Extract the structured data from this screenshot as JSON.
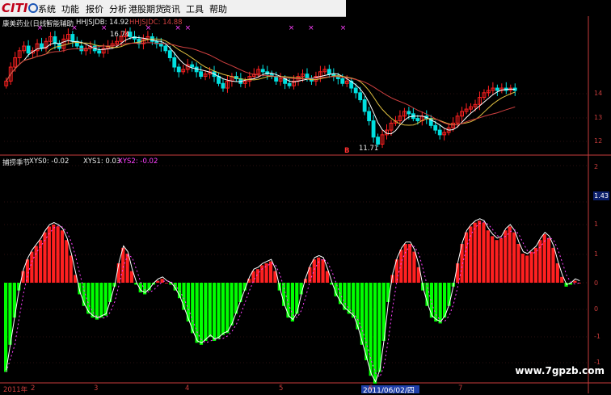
{
  "menu": {
    "logo_text": "CITI",
    "items": [
      "系统",
      "功能",
      "报价",
      "分析",
      "港股期货",
      "资讯",
      "工具",
      "帮助"
    ]
  },
  "top_panel": {
    "title": "康美药业(日线)",
    "indicator_name": "智能辅助",
    "line1_label": "HHJSJDB: 14.92",
    "line2_label": "HHJSJDC: 14.88",
    "high_marker": "16.74",
    "low_marker": "11.71",
    "y_ticks": [
      "14",
      "13",
      "12"
    ],
    "sell_marker_symbol": "×",
    "buy_marker_symbol": "B"
  },
  "bottom_panel": {
    "title": "捕捞季节",
    "xys0_label": "XYS0: -0.02",
    "xys1_label": "XYS1: 0.03",
    "xys2_label": "XYS2: -0.02",
    "current_value": "1.43",
    "y_ticks": [
      "2",
      "1",
      "1",
      "0",
      "0",
      "-1",
      "-1"
    ]
  },
  "x_axis": {
    "labels": [
      "2011年",
      "2",
      "3",
      "4",
      "5",
      "6",
      "7"
    ],
    "highlighted_date": "2011/06/02/四"
  },
  "watermark": "www.7gpzb.com",
  "colors": {
    "background": "#000000",
    "up": "#ff2020",
    "down": "#00e0e0",
    "hist_pos": "#ff2020",
    "hist_neg": "#00ff00",
    "ma_white": "#ffffff",
    "ma_red": "#d04040",
    "ma_yellow": "#e0c040",
    "title_color": "#e8e8e8",
    "xys2_color": "#ff40ff",
    "axis": "#c83c3c"
  },
  "chart_data": [
    {
      "type": "candlestick",
      "title": "康美药业(日线)",
      "ylim": [
        11.5,
        17.0
      ],
      "series_names": [
        "HHJSJDB",
        "HHJSJDC"
      ],
      "closes": [
        14.6,
        15.2,
        15.6,
        15.9,
        16.1,
        15.8,
        15.9,
        16.2,
        16.0,
        16.3,
        16.5,
        16.2,
        16.0,
        16.4,
        16.6,
        16.3,
        16.1,
        15.9,
        16.0,
        16.1,
        15.9,
        15.8,
        16.0,
        16.1,
        16.2,
        16.3,
        16.5,
        16.7,
        16.5,
        16.4,
        16.2,
        16.4,
        16.5,
        16.3,
        16.2,
        16.1,
        15.9,
        15.6,
        15.2,
        15.0,
        15.1,
        15.3,
        15.2,
        15.0,
        14.8,
        14.9,
        15.0,
        14.8,
        14.5,
        14.3,
        14.6,
        14.8,
        14.7,
        14.5,
        14.6,
        14.8,
        14.9,
        15.1,
        15.0,
        14.9,
        14.8,
        14.6,
        14.7,
        14.5,
        14.4,
        14.6,
        14.8,
        14.9,
        14.7,
        14.6,
        14.8,
        15.0,
        15.1,
        14.9,
        14.8,
        14.7,
        14.5,
        14.6,
        14.3,
        14.1,
        13.8,
        13.3,
        12.9,
        12.2,
        11.9,
        12.3,
        12.5,
        12.8,
        12.9,
        13.1,
        13.3,
        13.2,
        13.0,
        12.9,
        13.1,
        13.0,
        12.7,
        12.5,
        12.3,
        12.4,
        12.6,
        12.8,
        13.1,
        13.3,
        13.4,
        13.5,
        13.6,
        13.9,
        14.1,
        14.2,
        14.3,
        14.2,
        14.3,
        14.2,
        14.3,
        14.2
      ]
    },
    {
      "type": "bar",
      "title": "捕捞季节",
      "ylim": [
        -2.5,
        2.5
      ],
      "series_names": [
        "XYS0",
        "XYS1",
        "XYS2"
      ],
      "values": [
        -2.3,
        -1.6,
        -0.9,
        -0.2,
        0.3,
        0.6,
        0.8,
        0.95,
        1.1,
        1.3,
        1.45,
        1.5,
        1.45,
        1.35,
        1.1,
        0.7,
        0.2,
        -0.3,
        -0.6,
        -0.8,
        -0.9,
        -0.95,
        -0.9,
        -0.85,
        -0.5,
        -0.1,
        0.5,
        0.9,
        0.75,
        0.3,
        -0.05,
        -0.25,
        -0.3,
        -0.2,
        -0.05,
        0.05,
        0.1,
        0.0,
        -0.05,
        -0.2,
        -0.4,
        -0.7,
        -1.0,
        -1.3,
        -1.55,
        -1.6,
        -1.5,
        -1.4,
        -1.5,
        -1.45,
        -1.35,
        -1.3,
        -1.1,
        -0.8,
        -0.5,
        -0.2,
        0.1,
        0.3,
        0.35,
        0.45,
        0.5,
        0.55,
        0.3,
        -0.2,
        -0.6,
        -0.9,
        -1.0,
        -0.8,
        -0.3,
        0.1,
        0.4,
        0.6,
        0.65,
        0.6,
        0.3,
        -0.05,
        -0.35,
        -0.55,
        -0.7,
        -0.8,
        -0.9,
        -1.2,
        -1.6,
        -2.0,
        -2.4,
        -2.6,
        -2.3,
        -1.5,
        -0.5,
        0.2,
        0.6,
        0.85,
        1.0,
        1.0,
        0.8,
        0.4,
        -0.2,
        -0.6,
        -0.9,
        -1.0,
        -1.05,
        -0.9,
        -0.6,
        -0.1,
        0.5,
        1.0,
        1.3,
        1.45,
        1.55,
        1.6,
        1.55,
        1.35,
        1.2,
        1.1,
        1.15,
        1.35,
        1.45,
        1.3,
        1.0,
        0.75,
        0.7,
        0.8,
        0.9,
        1.1,
        1.25,
        1.15,
        0.9,
        0.5,
        0.15,
        -0.1,
        -0.05,
        0.05,
        0.0
      ]
    }
  ]
}
